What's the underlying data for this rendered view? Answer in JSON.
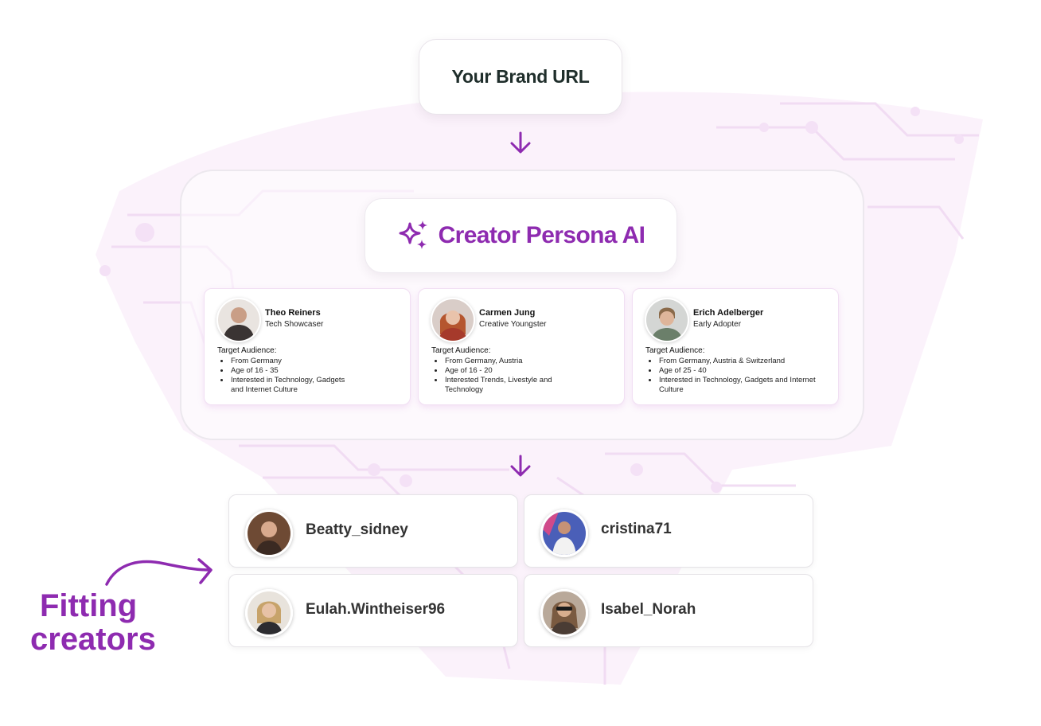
{
  "brand_box": {
    "label": "Your Brand URL"
  },
  "persona_ai": {
    "title": "Creator Persona AI",
    "icon": "sparkle-icon"
  },
  "personas": [
    {
      "name": "Theo Reiners",
      "role": "Tech Showcaser",
      "audience_label": "Target Audience:",
      "audience": [
        "From Germany",
        "Age of 16 - 35",
        "Interested in Technology, Gadgets and Internet Culture"
      ]
    },
    {
      "name": "Carmen Jung",
      "role": "Creative Youngster",
      "audience_label": "Target Audience:",
      "audience": [
        "From Germany, Austria",
        "Age of 16 - 20",
        "Interested Trends, Livestyle and Technology"
      ]
    },
    {
      "name": "Erich Adelberger",
      "role": "Early Adopter",
      "audience_label": "Target Audience:",
      "audience": [
        "From Germany, Austria & Switzerland",
        "Age of 25 - 40",
        "Interested in Technology, Gadgets and Internet Culture"
      ]
    }
  ],
  "creators": [
    {
      "username": "Beatty_sidney"
    },
    {
      "username": "cristina71"
    },
    {
      "username": "Eulah.Wintheiser96"
    },
    {
      "username": "Isabel_Norah"
    }
  ],
  "callout": {
    "line1": "Fitting",
    "line2": "creators"
  },
  "colors": {
    "accent": "#8e2bb0",
    "dark_text": "#1f2e2b",
    "deco": "#f4e3f6"
  }
}
